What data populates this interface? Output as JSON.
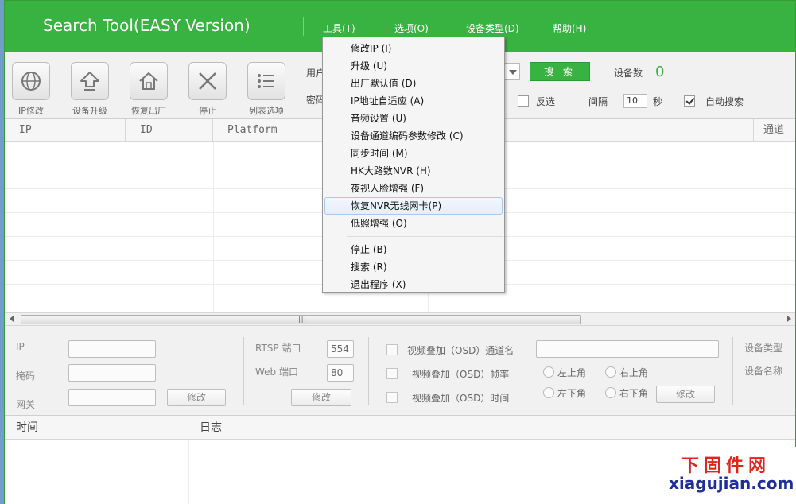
{
  "app": {
    "title": "Search Tool(EASY Version)"
  },
  "menu": [
    {
      "label": "工具(T)"
    },
    {
      "label": "选项(O)"
    },
    {
      "label": "设备类型(D)"
    },
    {
      "label": "帮助(H)"
    }
  ],
  "toolbar": {
    "buttons": [
      {
        "label": "IP修改",
        "icon": "globe-icon"
      },
      {
        "label": "设备升级",
        "icon": "upload-arrow-icon"
      },
      {
        "label": "恢复出厂",
        "icon": "home-icon"
      },
      {
        "label": "停止",
        "icon": "close-x-icon"
      },
      {
        "label": "列表选项",
        "icon": "list-icon"
      }
    ],
    "user_label": "用户",
    "password_label": "密码",
    "search_label": "搜 索",
    "device_count_label": "设备数",
    "device_count": "0",
    "invert_label": "反选",
    "interval_label": "间隔",
    "interval_value": "10",
    "interval_unit": "秒",
    "auto_search_label": "自动搜索",
    "auto_search_checked": true
  },
  "device_table": {
    "columns": [
      "IP",
      "ID",
      "Platform",
      "通道"
    ]
  },
  "config": {
    "ip_label": "IP",
    "mask_label": "掩码",
    "gateway_label": "网关",
    "modify_label": "修改",
    "rtsp_label": "RTSP 端口",
    "rtsp_value": "554",
    "web_label": "Web 端口",
    "web_value": "80",
    "osd_channel_label": "视频叠加（OSD）通道名",
    "osd_framerate_label": "视频叠加（OSD）帧率",
    "osd_time_label": "视频叠加（OSD）时间",
    "pos_top_left": "左上角",
    "pos_top_right": "右上角",
    "pos_bottom_left": "左下角",
    "pos_bottom_right": "右下角",
    "device_type_label": "设备类型",
    "device_name_label": "设备名称"
  },
  "log": {
    "columns": [
      "时间",
      "日志"
    ]
  },
  "tools_menu": {
    "items": [
      "修改IP (I)",
      "升级 (U)",
      "出厂默认值 (D)",
      "IP地址自适应 (A)",
      "音频设置 (U)",
      "设备通道编码参数修改 (C)",
      "同步时间 (M)",
      "HK大路数NVR (H)",
      "夜视人脸增强 (F)",
      "恢复NVR无线网卡(P)",
      "低照增强 (O)"
    ],
    "items2": [
      "停止 (B)",
      "搜索 (R)",
      "退出程序 (X)"
    ],
    "hovered_index": 9
  },
  "watermark": {
    "cn": "下固件网",
    "en": "xiagujian.com"
  },
  "colors": {
    "accent": "#38b241",
    "count": "#38b241"
  }
}
